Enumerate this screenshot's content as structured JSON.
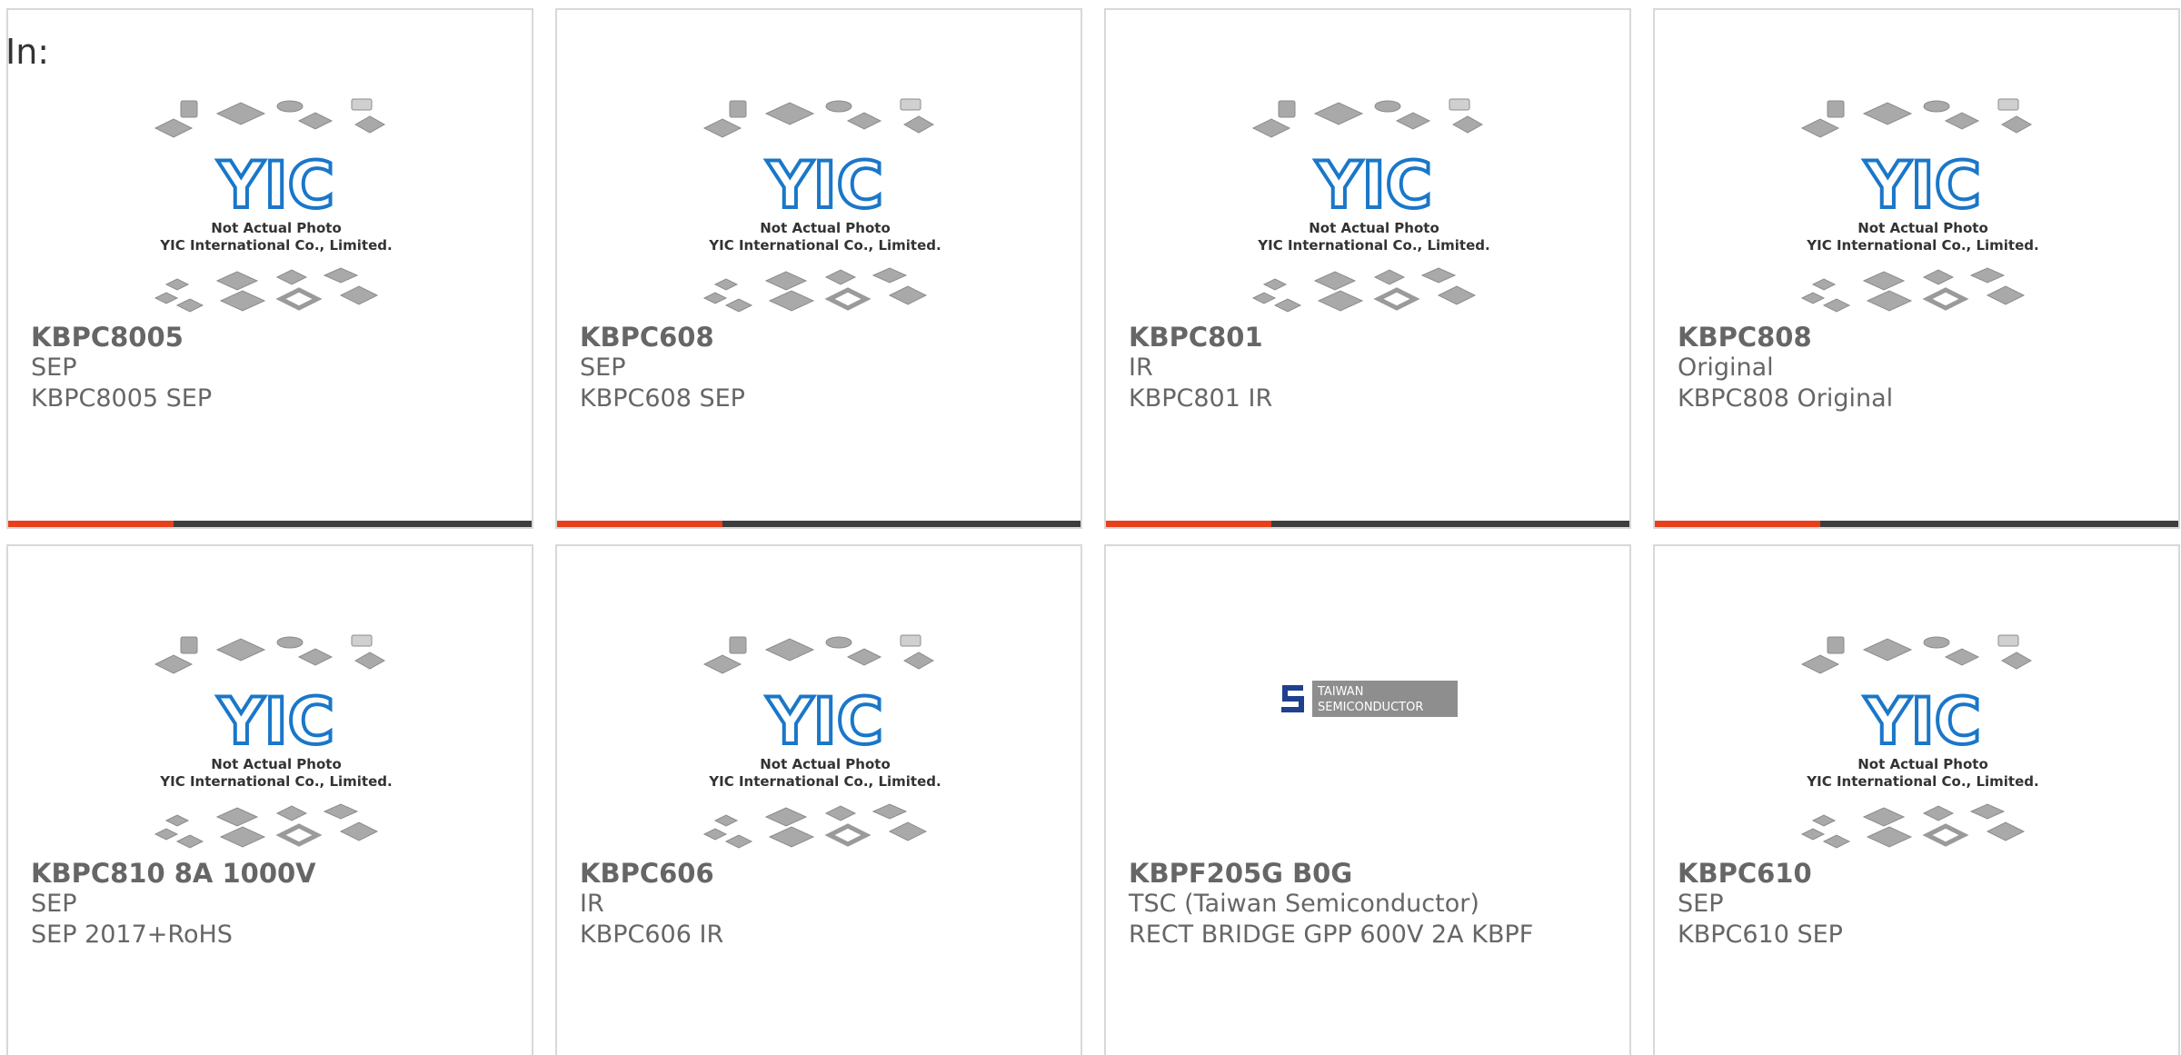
{
  "header": {
    "label": "In:"
  },
  "placeholder_photo": {
    "line1": "Not Actual Photo",
    "line2": "YIC International Co., Limited.",
    "logo_text": "YIC"
  },
  "tsc_logo": {
    "line1": "TAIWAN",
    "line2": "SEMICONDUCTOR"
  },
  "colors": {
    "bar_accent": "#e8401c",
    "bar_rest": "#3d3d3d",
    "text": "#666666",
    "card_border": "#d8d8d8",
    "logo_blue": "#1a77c9"
  },
  "products": [
    {
      "part": "KBPC8005",
      "brand": "SEP",
      "desc": "KBPC8005 SEP",
      "image": "placeholder"
    },
    {
      "part": "KBPC608",
      "brand": "SEP",
      "desc": "KBPC608 SEP",
      "image": "placeholder"
    },
    {
      "part": "KBPC801",
      "brand": "IR",
      "desc": "KBPC801 IR",
      "image": "placeholder"
    },
    {
      "part": "KBPC808",
      "brand": "Original",
      "desc": "KBPC808 Original",
      "image": "placeholder"
    },
    {
      "part": "KBPC810 8A 1000V",
      "brand": "SEP",
      "desc": "SEP 2017+RoHS",
      "image": "placeholder"
    },
    {
      "part": "KBPC606",
      "brand": "IR",
      "desc": "KBPC606 IR",
      "image": "placeholder"
    },
    {
      "part": "KBPF205G B0G",
      "brand": "TSC (Taiwan Semiconductor)",
      "desc": "RECT BRIDGE GPP 600V 2A KBPF",
      "image": "tsc-logo"
    },
    {
      "part": "KBPC610",
      "brand": "SEP",
      "desc": "KBPC610 SEP",
      "image": "placeholder"
    }
  ]
}
